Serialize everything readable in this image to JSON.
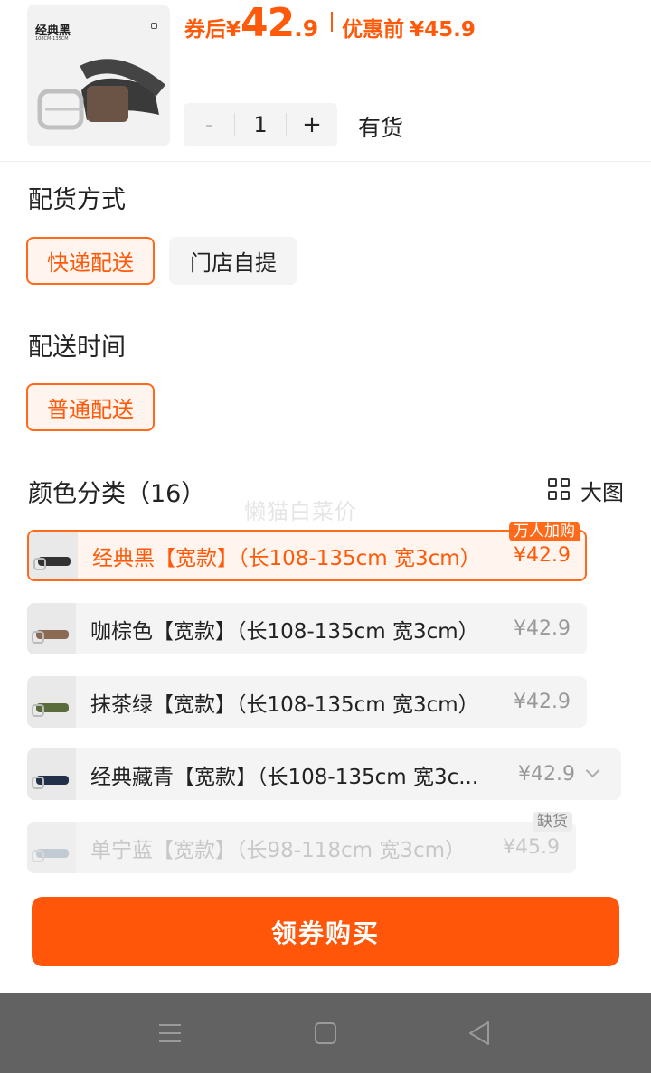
{
  "product": {
    "thumb_label": "经典黑",
    "thumb_size": "108CM-135CM",
    "price_prefix": "券后",
    "currency": "¥",
    "price_int": "42",
    "price_dec": ".9",
    "original_label": "优惠前",
    "original_price": "¥45.9"
  },
  "quantity": {
    "minus": "-",
    "value": "1",
    "plus": "+"
  },
  "stock_status": "有货",
  "delivery_method": {
    "title": "配货方式",
    "options": [
      {
        "label": "快递配送",
        "selected": true
      },
      {
        "label": "门店自提",
        "selected": false
      }
    ]
  },
  "delivery_time": {
    "title": "配送时间",
    "options": [
      {
        "label": "普通配送",
        "selected": true
      }
    ]
  },
  "color": {
    "title": "颜色分类（16）",
    "view_large_label": "大图"
  },
  "watermark": "懒猫白菜价",
  "variants": [
    {
      "name": "经典黑【宽款】（长108-135cm 宽3cm）",
      "price": "¥42.9",
      "badge": "万人加购",
      "state": "selected"
    },
    {
      "name": "咖棕色【宽款】（长108-135cm 宽3cm）",
      "price": "¥42.9",
      "state": "normal"
    },
    {
      "name": "抹茶绿【宽款】（长108-135cm 宽3cm）",
      "price": "¥42.9",
      "state": "normal"
    },
    {
      "name": "经典藏青【宽款】（长108-135cm 宽3c...",
      "price": "¥42.9",
      "state": "normal"
    },
    {
      "name": "单宁蓝【宽款】（长98-118cm 宽3cm）",
      "price": "¥45.9",
      "badge": "缺货",
      "state": "disabled"
    }
  ],
  "buy_button_label": "领券购买",
  "colors": {
    "accent": "#ff5a0a",
    "button": "#ff560a",
    "navbar": "#626262"
  },
  "icons": [
    "grid-icon",
    "chevron-down-icon",
    "menu-icon",
    "home-icon",
    "back-icon"
  ]
}
